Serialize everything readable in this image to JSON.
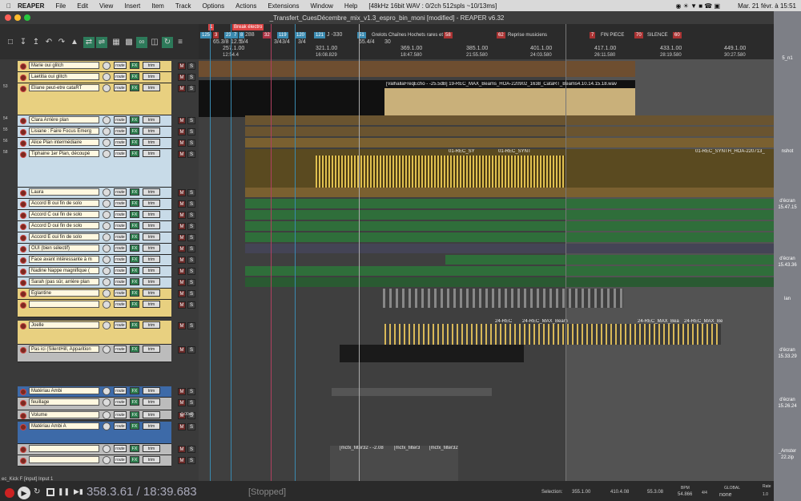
{
  "menubar": {
    "apple": "",
    "app": "REAPER",
    "items": [
      "File",
      "Edit",
      "View",
      "Insert",
      "Item",
      "Track",
      "Options",
      "Actions",
      "Extensions",
      "Window",
      "Help"
    ],
    "status": "[48kHz 16bit WAV : 0/2ch 512spls ~10/13ms]",
    "clock": "Mar. 21 févr. à 15:51"
  },
  "window": {
    "title": "_Transfert_CuesDécembre_mix_v1.3_espro_bin_moni [modified] - REAPER v6.32"
  },
  "ruler": {
    "markers": [
      {
        "label": "1",
        "color": "#d44"
      },
      {
        "label": "Break électro",
        "color": "#d44"
      },
      {
        "label": "125",
        "color": "#3a8ab0"
      },
      {
        "label": "3",
        "color": "#a33"
      },
      {
        "label": "23",
        "color": "#3a8ab0"
      },
      {
        "label": "7",
        "color": "#3a8ab0"
      },
      {
        "label": "8",
        "color": "#3a8ab0"
      },
      {
        "label": "32",
        "color": "#a34"
      },
      {
        "label": "119",
        "color": "#3a8ab0"
      },
      {
        "label": "120",
        "color": "#3a8ab0"
      },
      {
        "label": "121",
        "color": "#3a8ab0"
      },
      {
        "label": "51",
        "color": "#3a8ab0"
      }
    ],
    "tempo_labels": [
      "65.3/8",
      "5/4",
      "3/4",
      "3/4",
      "3/4",
      "J -330",
      "65.4/4",
      "30"
    ],
    "small_labels": [
      "288",
      "12.5"
    ],
    "regions": [
      {
        "label": "Grelots Chaînes Hochets rares et",
        "num": "58"
      },
      {
        "label": "Reprise musiciens",
        "num": "62"
      },
      {
        "label": "FIN PIECE",
        "num": "7"
      },
      {
        "label": "SILENCE",
        "num": "70"
      },
      {
        "label": "",
        "num": "60"
      }
    ],
    "bars": [
      "257.1.00",
      "321.1.00",
      "369.1.00",
      "385.1.00",
      "401.1.00",
      "417.1.00",
      "433.1.00",
      "449.1.00"
    ],
    "times": [
      "12:54.4",
      "16:08.829",
      "18:47.580",
      "21:55.580",
      "24:03.580",
      "26:11.580",
      "28:19.580",
      "30:27.580"
    ]
  },
  "tracks": [
    {
      "num": "",
      "name": "Marie oui glitch",
      "color": "#e8d080"
    },
    {
      "num": "",
      "name": "Laetitia oui glitch",
      "color": "#e8d080"
    },
    {
      "num": "53",
      "name": "Eliane peut-etre cataRT",
      "color": "#e8d080"
    },
    {
      "num": "54",
      "name": "Clara Arrière plan",
      "color": "#c8dbe8"
    },
    {
      "num": "55",
      "name": "Lisiane : Faire Focus Emerg",
      "color": "#c8dbe8"
    },
    {
      "num": "56",
      "name": "Alice Plan intermédiaire",
      "color": "#c8dbe8"
    },
    {
      "num": "58",
      "name": "Tiphaine 1er Plan, découpé",
      "color": "#c8dbe8"
    },
    {
      "num": "",
      "name": "Laura",
      "color": "#c8dbe8"
    },
    {
      "num": "",
      "name": "Accord B oui fin de solo",
      "color": "#c8dbe8"
    },
    {
      "num": "",
      "name": "Accord C oui fin de solo",
      "color": "#c8dbe8"
    },
    {
      "num": "",
      "name": "Accord D oui fin de solo",
      "color": "#c8dbe8"
    },
    {
      "num": "",
      "name": "Accord E oui fin de solo",
      "color": "#c8dbe8"
    },
    {
      "num": "",
      "name": "OUI (bien sélectif)",
      "color": "#c8dbe8"
    },
    {
      "num": "",
      "name": "Face avant intéressante à m",
      "color": "#c8dbe8"
    },
    {
      "num": "",
      "name": "Nadine Nappe magnifique (",
      "color": "#c8dbe8"
    },
    {
      "num": "",
      "name": "Sarah (pas sûr, arrière plan",
      "color": "#c8dbe8"
    },
    {
      "num": "",
      "name": "Eglantine",
      "color": "#e8d080"
    },
    {
      "num": "",
      "name": "",
      "color": "#e8d080"
    },
    {
      "num": "",
      "name": "Joelle",
      "color": "#e8d080"
    },
    {
      "num": "",
      "name": "Pas ici (SilentHill, Apparition",
      "color": "#bcbcbc"
    },
    {
      "num": "",
      "name": "Matériau Ambi",
      "color": "#3d6aa8"
    },
    {
      "num": "",
      "name": "feuillage",
      "color": "#bcbcbc"
    },
    {
      "num": "",
      "name": "Volume",
      "color": "#bcbcbc"
    },
    {
      "num": "",
      "name": "Matériau Ambi A",
      "color": "#3d6aa8"
    },
    {
      "num": "",
      "name": "",
      "color": "#bcbcbc"
    },
    {
      "num": "",
      "name": "",
      "color": "#bcbcbc"
    }
  ],
  "buttons": {
    "route": "route",
    "fx": "FX",
    "trim": "trim",
    "mute": "M",
    "solo": "S"
  },
  "volume_value": "0.00dB",
  "items": {
    "label1": "[ValhallaFreqEcho - -25.5dB] 19-REC_MAX_Beams_HOA-220902_1638_CataRT_Beams4.10.14.15.18.wav",
    "label2": "01-REC_SY",
    "label3": "01-REC_SYNT",
    "label4": "01-REC_SYNTH_HOA-220713_",
    "label5": "24-REC",
    "label6": "24-REC_MAX_Beam",
    "label7": "24-REC_MAX_Bea",
    "label8": "24-REC_MAX_Be",
    "fx1": "[mcfx_filter32 - -2.08",
    "fx2": "[mcfx_filter3",
    "fx3": "[mcfx_filter32"
  },
  "transport": {
    "position": "358.3.61 / 18:39.683",
    "state": "[Stopped]",
    "input": "ec_Kick F [input] Input 1",
    "selection_label": "Selection:",
    "sel_start": "355.1.00",
    "sel_end": "410.4.08",
    "sel_len": "55.3.08",
    "bpm_label": "BPM",
    "bpm": "54.866",
    "ts": "4/4",
    "global_label": "GLOBAL",
    "none_label": "none",
    "rate_label": "Rate",
    "rate": "1.0"
  },
  "desktop": [
    "5_n1",
    "nshot",
    "d'écran",
    "15.47.15",
    "d'écran",
    "15.43.36",
    "lan",
    "d'écran",
    "15.33.29",
    "d'écran",
    "15.26.24",
    "_Amster",
    "22.zip"
  ]
}
